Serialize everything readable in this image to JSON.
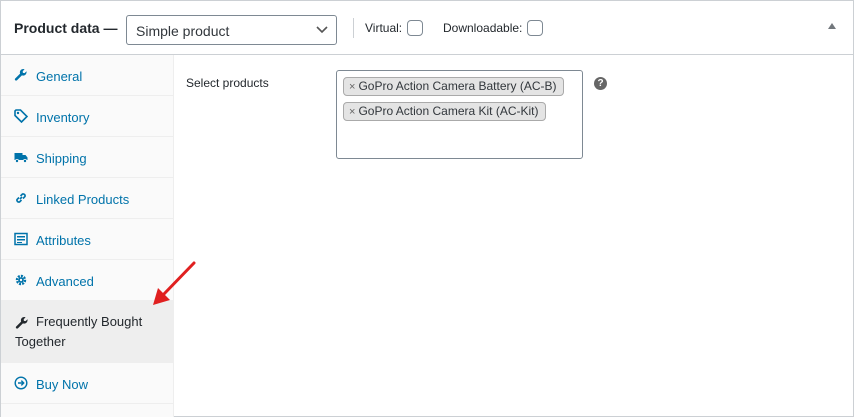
{
  "header": {
    "title": "Product data —",
    "product_type": "Simple product",
    "virtual_label": "Virtual:",
    "virtual_checked": false,
    "downloadable_label": "Downloadable:",
    "downloadable_checked": false
  },
  "sidebar": {
    "items": [
      {
        "label": "General",
        "icon": "wrench-icon"
      },
      {
        "label": "Inventory",
        "icon": "tag-icon"
      },
      {
        "label": "Shipping",
        "icon": "truck-icon"
      },
      {
        "label": "Linked Products",
        "icon": "link-icon"
      },
      {
        "label": "Attributes",
        "icon": "list-icon"
      },
      {
        "label": "Advanced",
        "icon": "gear-icon"
      },
      {
        "label": "Frequently Bought Together",
        "icon": "wrench-icon",
        "active": true
      },
      {
        "label": "Buy Now",
        "icon": "circle-arrow-right-icon"
      }
    ]
  },
  "content": {
    "field_label": "Select products",
    "selected": [
      "GoPro Action Camera Battery (AC-B)",
      "GoPro Action Camera Kit (AC-Kit)"
    ],
    "chip_remove_symbol": "×",
    "help_symbol": "?"
  },
  "colors": {
    "link": "#0073aa",
    "border": "#ccd0d4",
    "annotation_arrow": "#e02020"
  }
}
